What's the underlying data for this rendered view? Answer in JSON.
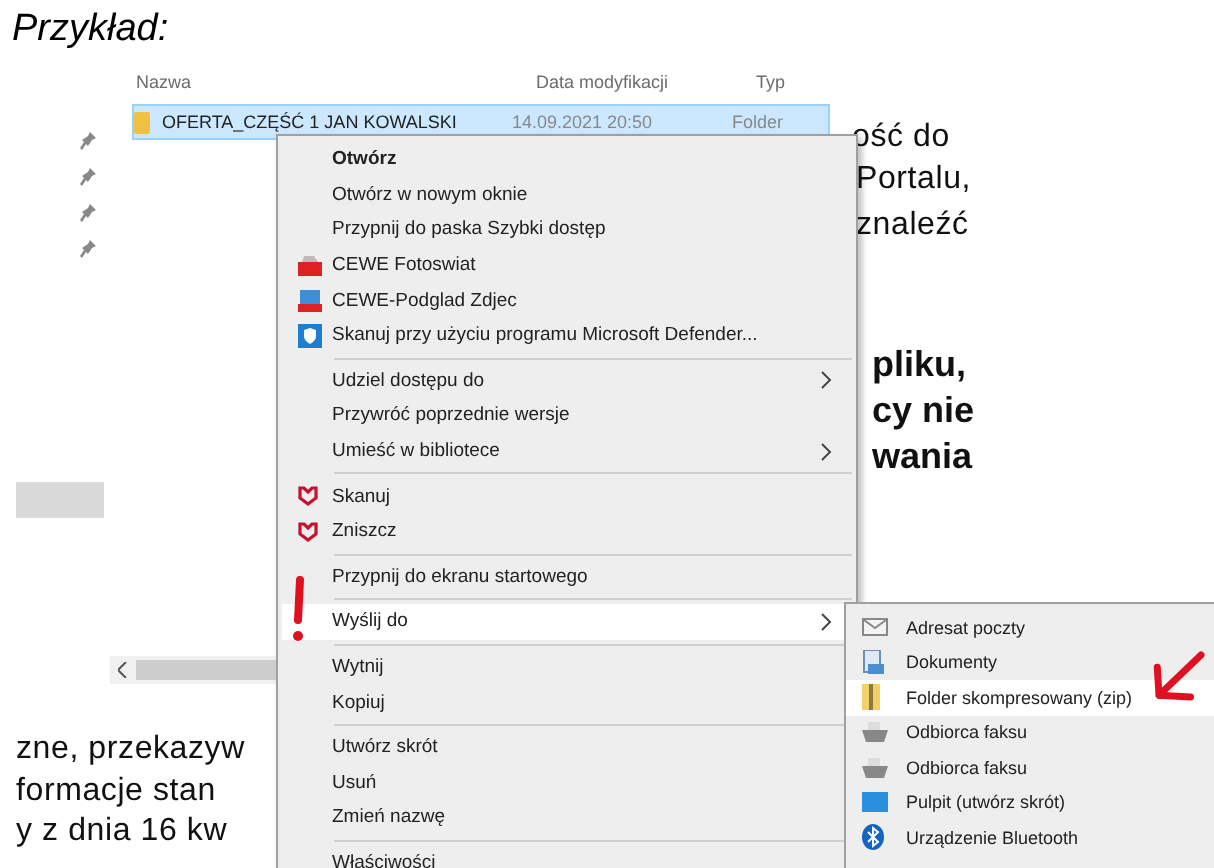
{
  "document": {
    "heading": "Przykład:",
    "fragments": [
      {
        "text": "ość do",
        "kind": "normal"
      },
      {
        "text": "Portalu,",
        "kind": "normal"
      },
      {
        "text": "znaleźć",
        "kind": "normal"
      },
      {
        "text": "pliku,",
        "kind": "bold"
      },
      {
        "text": "cy nie",
        "kind": "bold"
      },
      {
        "text": "wania",
        "kind": "bold"
      },
      {
        "text": "zne, przekazyw",
        "kind": "normal"
      },
      {
        "text": "formacje  stan",
        "kind": "normal"
      },
      {
        "text": "y z dnia 16 kw",
        "kind": "normal"
      }
    ]
  },
  "explorer": {
    "columns": [
      "Nazwa",
      "Data modyfikacji",
      "Typ"
    ],
    "rows": [
      {
        "name": "OFERTA_CZĘŚĆ 1 JAN KOWALSKI",
        "date": "14.09.2021 20:50",
        "type": "Folder",
        "selected": true
      }
    ]
  },
  "context_menu": {
    "items": [
      {
        "kind": "item",
        "label": "Otwórz",
        "bold": true,
        "submenu": false,
        "selected": false
      },
      {
        "kind": "item",
        "label": "Otwórz w nowym oknie",
        "bold": false,
        "submenu": false,
        "selected": false
      },
      {
        "kind": "item",
        "label": "Przypnij do paska Szybki dostęp",
        "bold": false,
        "submenu": false,
        "selected": false
      },
      {
        "kind": "item",
        "label": "CEWE Fotoswiat",
        "bold": false,
        "submenu": false,
        "selected": false
      },
      {
        "kind": "item",
        "label": "CEWE-Podglad Zdjec",
        "bold": false,
        "submenu": false,
        "selected": false
      },
      {
        "kind": "item",
        "label": "Skanuj przy użyciu programu Microsoft Defender...",
        "bold": false,
        "submenu": false,
        "selected": false
      },
      {
        "kind": "separator"
      },
      {
        "kind": "item",
        "label": "Udziel dostępu do",
        "bold": false,
        "submenu": true,
        "selected": false
      },
      {
        "kind": "item",
        "label": "Przywróć poprzednie wersje",
        "bold": false,
        "submenu": false,
        "selected": false
      },
      {
        "kind": "item",
        "label": "Umieść w bibliotece",
        "bold": false,
        "submenu": true,
        "selected": false
      },
      {
        "kind": "separator"
      },
      {
        "kind": "item",
        "label": "Skanuj",
        "bold": false,
        "submenu": false,
        "selected": false
      },
      {
        "kind": "item",
        "label": "Zniszcz",
        "bold": false,
        "submenu": false,
        "selected": false
      },
      {
        "kind": "separator"
      },
      {
        "kind": "item",
        "label": "Przypnij do ekranu startowego",
        "bold": false,
        "submenu": false,
        "selected": false
      },
      {
        "kind": "separator"
      },
      {
        "kind": "item",
        "label": "Wyślij do",
        "bold": false,
        "submenu": true,
        "selected": true
      },
      {
        "kind": "separator"
      },
      {
        "kind": "item",
        "label": "Wytnij",
        "bold": false,
        "submenu": false,
        "selected": false
      },
      {
        "kind": "item",
        "label": "Kopiuj",
        "bold": false,
        "submenu": false,
        "selected": false
      },
      {
        "kind": "separator"
      },
      {
        "kind": "item",
        "label": "Utwórz skrót",
        "bold": false,
        "submenu": false,
        "selected": false
      },
      {
        "kind": "item",
        "label": "Usuń",
        "bold": false,
        "submenu": false,
        "selected": false
      },
      {
        "kind": "item",
        "label": "Zmień nazwę",
        "bold": false,
        "submenu": false,
        "selected": false
      },
      {
        "kind": "separator"
      },
      {
        "kind": "item",
        "label": "Właściwości",
        "bold": false,
        "submenu": false,
        "selected": false
      }
    ]
  },
  "send_to_menu": {
    "items": [
      {
        "label": "Adresat poczty",
        "selected": false
      },
      {
        "label": "Dokumenty",
        "selected": false
      },
      {
        "label": "Folder skompresowany (zip)",
        "selected": true
      },
      {
        "label": "Odbiorca faksu",
        "selected": false
      },
      {
        "label": "Odbiorca faksu",
        "selected": false
      },
      {
        "label": "Pulpit (utwórz skrót)",
        "selected": false
      },
      {
        "label": "Urządzenie Bluetooth",
        "selected": false
      }
    ]
  }
}
